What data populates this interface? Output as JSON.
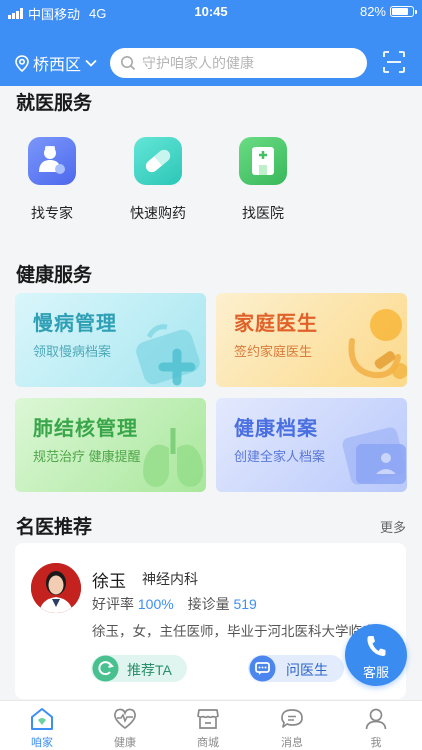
{
  "status_bar": {
    "carrier": "中国移动",
    "network": "4G",
    "time": "10:45",
    "battery": "82%"
  },
  "header": {
    "location": "桥西区",
    "search_placeholder": "守护咱家人的健康"
  },
  "medical_services": {
    "title": "就医服务",
    "items": [
      {
        "label": "找专家",
        "icon": "doctor-icon",
        "color": "#5b7cf5"
      },
      {
        "label": "快速购药",
        "icon": "pill-icon",
        "color": "#3fd2c3"
      },
      {
        "label": "找医院",
        "icon": "hospital-icon",
        "color": "#4cc96b"
      }
    ]
  },
  "health_services": {
    "title": "健康服务",
    "cards": [
      {
        "title": "慢病管理",
        "subtitle": "领取慢病档案",
        "icon": "medical-kit-icon",
        "color": "#2e9fb5"
      },
      {
        "title": "家庭医生",
        "subtitle": "签约家庭医生",
        "icon": "stethoscope-icon",
        "color": "#e0622a"
      },
      {
        "title": "肺结核管理",
        "subtitle": "规范治疗  健康提醒",
        "icon": "lungs-icon",
        "color": "#3aa64a"
      },
      {
        "title": "健康档案",
        "subtitle": "创建全家人档案",
        "icon": "folder-icon",
        "color": "#4a6fe0"
      }
    ]
  },
  "famous_doctors": {
    "title": "名医推荐",
    "more": "更多",
    "doctor": {
      "name": "徐玉",
      "department": "神经内科",
      "rating_label": "好评率",
      "rating": "100%",
      "consult_label": "接诊量",
      "consult_count": "519",
      "bio": "徐玉，女，主任医师，毕业于河北医科大学临床",
      "recommend_button": "推荐TA",
      "ask_button": "问医生"
    }
  },
  "fab": {
    "label": "客服"
  },
  "tabbar": [
    {
      "label": "咱家",
      "icon": "home-icon",
      "active": true
    },
    {
      "label": "健康",
      "icon": "heartbeat-icon"
    },
    {
      "label": "商城",
      "icon": "shop-icon"
    },
    {
      "label": "消息",
      "icon": "message-icon"
    },
    {
      "label": "我",
      "icon": "user-icon"
    }
  ]
}
